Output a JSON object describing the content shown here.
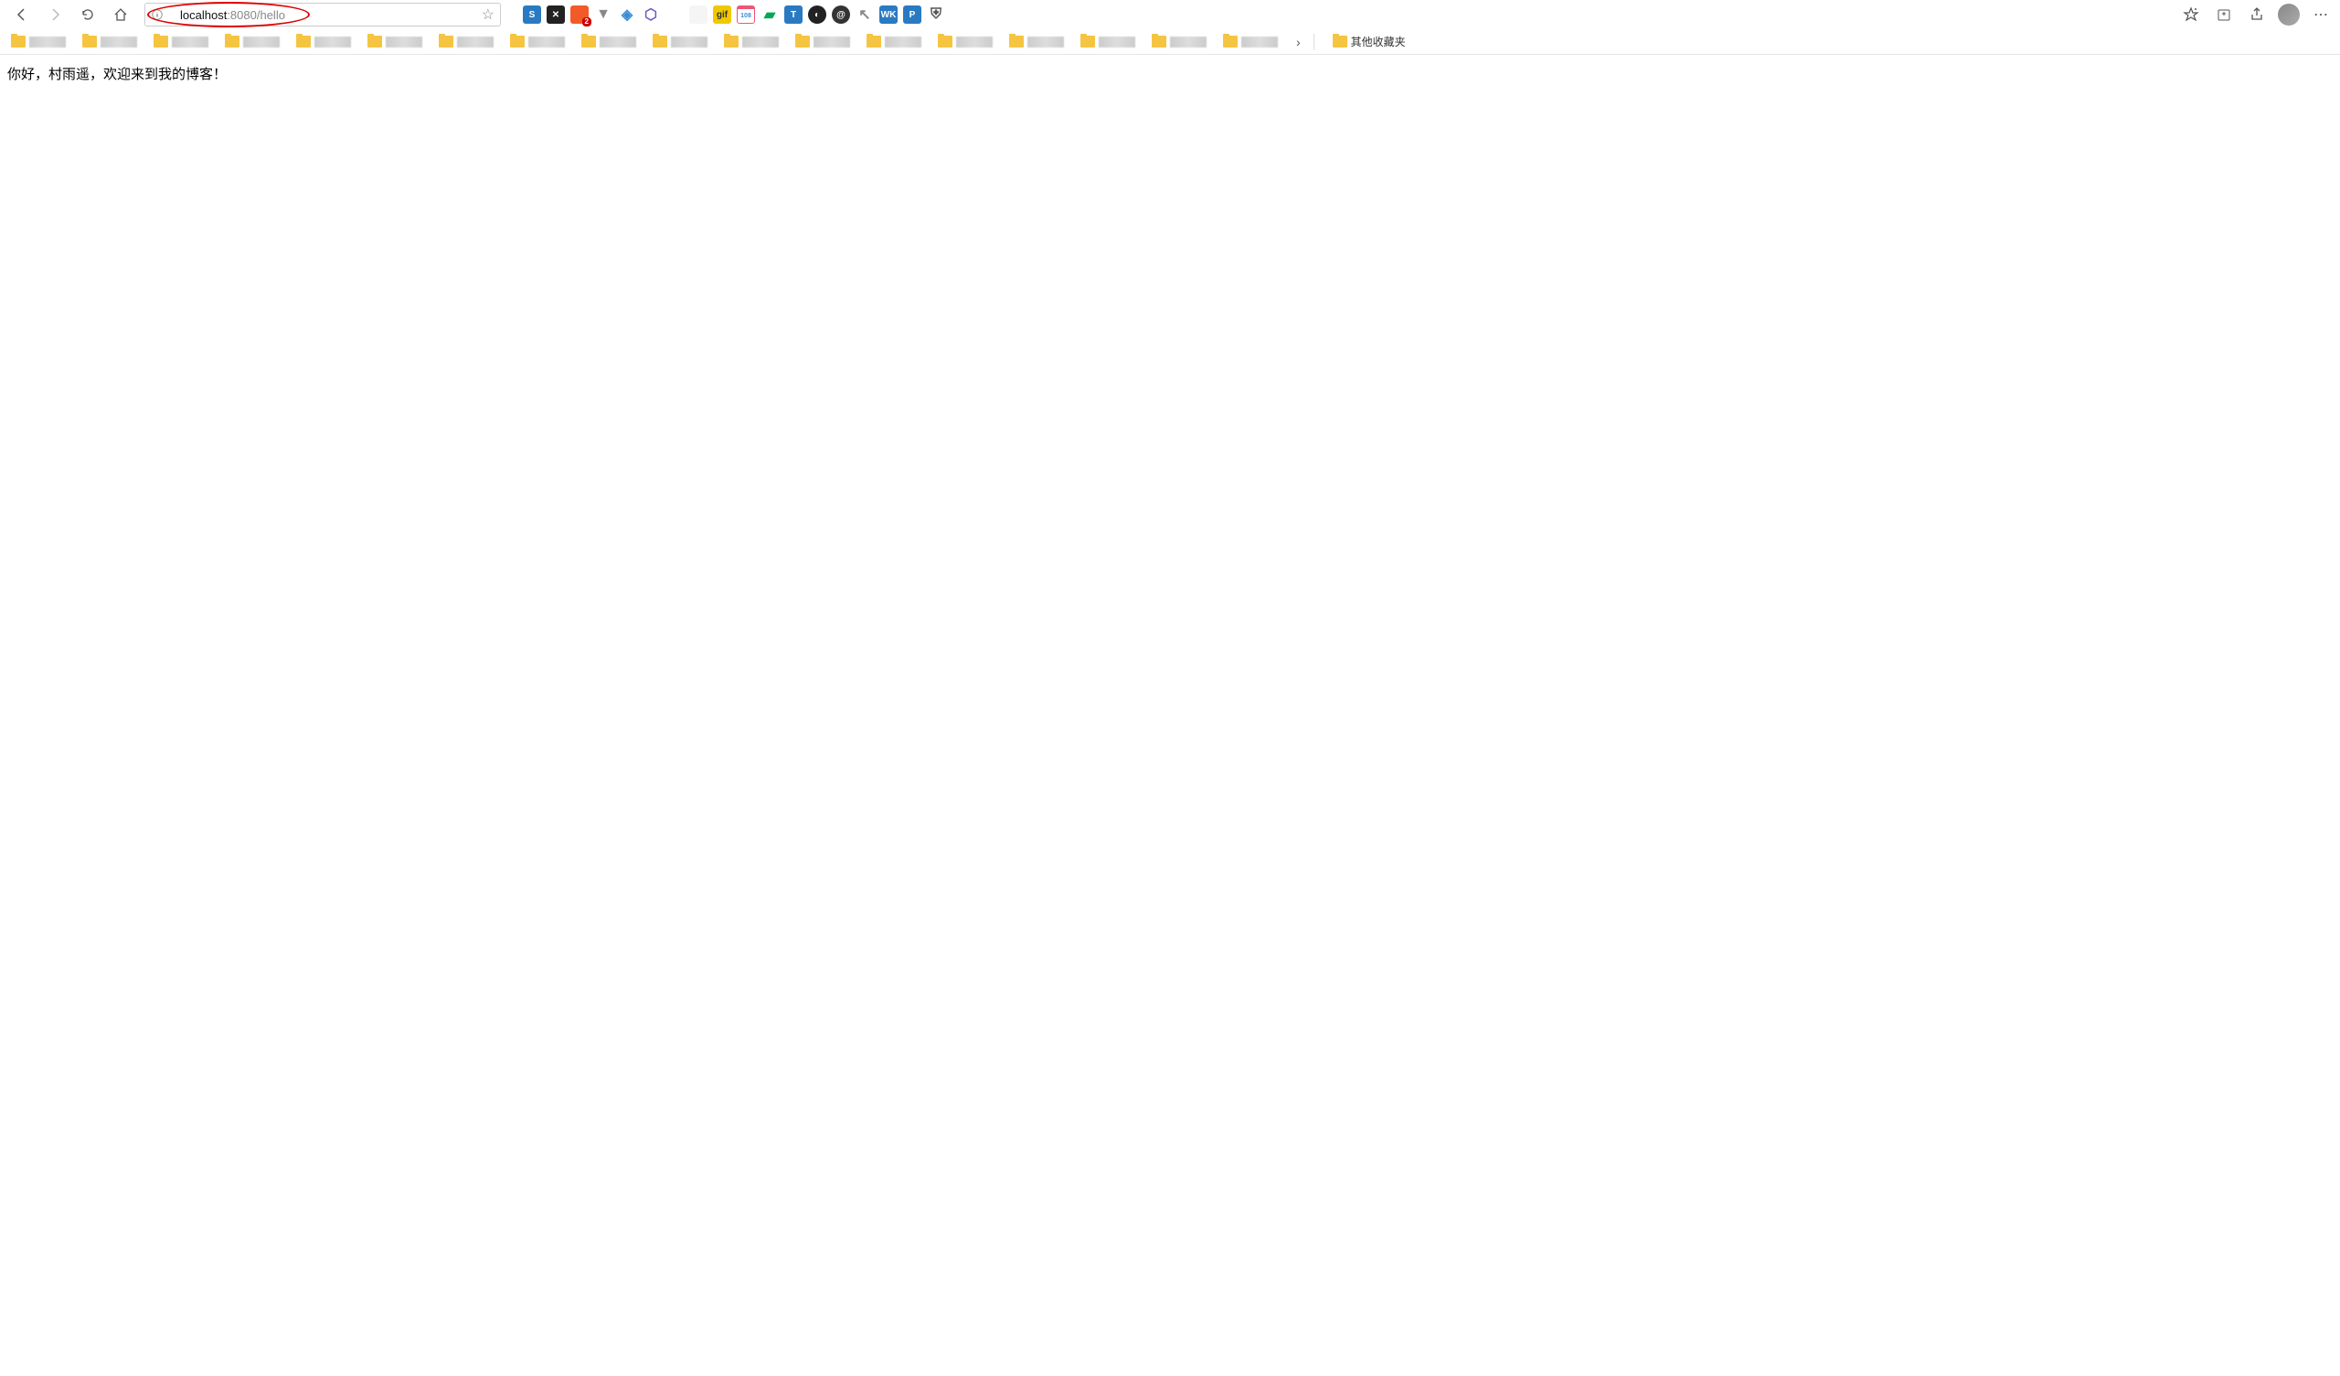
{
  "address_bar": {
    "url_host": "localhost",
    "url_port": ":8080",
    "url_path": "/hello"
  },
  "extensions": [
    {
      "name": "ext-s",
      "bg": "#2a7ac2",
      "glyph": "S"
    },
    {
      "name": "ext-x",
      "bg": "#222",
      "glyph": "✕"
    },
    {
      "name": "ext-brave",
      "bg": "#f25a29",
      "glyph": "",
      "badge": "2"
    },
    {
      "name": "ext-v",
      "bg": "transparent",
      "glyph": "▼",
      "color": "#888"
    },
    {
      "name": "ext-shield",
      "bg": "transparent",
      "glyph": "◈",
      "color": "#3b8cd6"
    },
    {
      "name": "ext-cube",
      "bg": "transparent",
      "glyph": "⬡",
      "color": "#6a5acd"
    },
    {
      "name": "ext-calendar",
      "bg": "transparent",
      "glyph": "",
      "color": "#4a6"
    },
    {
      "name": "ext-blank",
      "bg": "#f5f5f5",
      "glyph": ""
    },
    {
      "name": "ext-gif",
      "bg": "#f0c800",
      "glyph": "gif",
      "color": "#333"
    },
    {
      "name": "ext-cal108",
      "bg": "#fff",
      "glyph": "108",
      "color": "#3b8cd6",
      "badge_style": "calendar"
    },
    {
      "name": "ext-green",
      "bg": "transparent",
      "glyph": "▰",
      "color": "#0a5"
    },
    {
      "name": "ext-t",
      "bg": "#2a7ac2",
      "glyph": "T"
    },
    {
      "name": "ext-globe",
      "bg": "#222",
      "glyph": "◐",
      "round": true
    },
    {
      "name": "ext-at",
      "bg": "#333",
      "glyph": "@",
      "round": true
    },
    {
      "name": "ext-cursor",
      "bg": "transparent",
      "glyph": "↖",
      "color": "#888"
    },
    {
      "name": "ext-wk",
      "bg": "#2a7ac2",
      "glyph": "WK"
    },
    {
      "name": "ext-p",
      "bg": "#2a7ac2",
      "glyph": "P"
    },
    {
      "name": "ext-shield2",
      "bg": "transparent",
      "glyph": "⛨",
      "color": "#555"
    }
  ],
  "bookmarks": {
    "count": 18,
    "other_label": "其他收藏夹"
  },
  "page": {
    "body_text": "你好，村雨遥，欢迎来到我的博客！"
  }
}
